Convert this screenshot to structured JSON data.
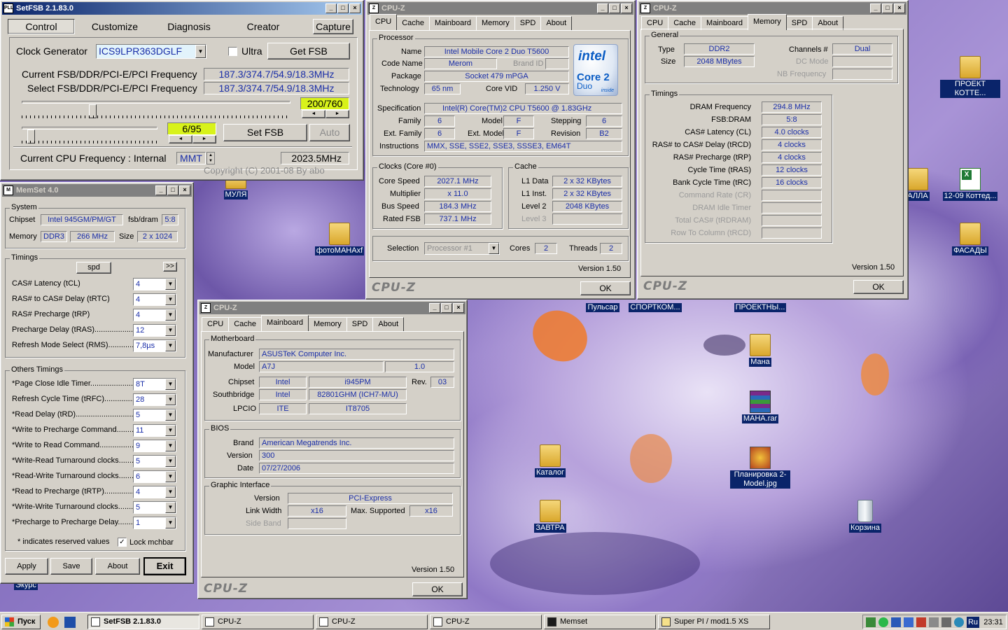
{
  "setfsb": {
    "title": "SetFSB 2.1.83.0",
    "tabs": [
      "Control",
      "Customize",
      "Diagnosis",
      "Creator"
    ],
    "capture": "Capture",
    "clock_label": "Clock Generator",
    "clock_value": "ICS9LPR363DGLF",
    "ultra": "Ultra",
    "get_fsb": "Get FSB",
    "current_label": "Current FSB/DDR/PCI-E/PCI Frequency",
    "current_value": "187.3/374.7/54.9/18.3MHz",
    "select_label": "Select FSB/DDR/PCI-E/PCI Frequency",
    "select_value": "187.3/374.7/54.9/18.3MHz",
    "range1": "200/760",
    "range2": "6/95",
    "set_fsb": "Set FSB",
    "auto": "Auto",
    "cpu_freq_label": "Current CPU Frequency : Internal",
    "mmt": "MMT",
    "cpu_freq_value": "2023.5MHz",
    "copyright": "Copyright (C) 2001-08 By abo"
  },
  "memset": {
    "title": "MemSet 4.0",
    "system": "System",
    "chipset_label": "Chipset",
    "chipset": "Intel 945GM/PM/GT",
    "fsbdram_label": "fsb/dram",
    "fsbdram": "5:8",
    "memory_label": "Memory",
    "mem_type": "DDR3",
    "mem_speed": "266 MHz",
    "size_label": "Size",
    "size": "2 x 1024",
    "timings": "Timings",
    "spd": "spd",
    "more": ">>",
    "timing_rows": [
      {
        "label": "CAS# Latency (tCL)",
        "value": "4"
      },
      {
        "label": "RAS# to CAS# Delay (tRTC)",
        "value": "4"
      },
      {
        "label": "RAS# Precharge (tRP)",
        "value": "4"
      },
      {
        "label": "Precharge Delay  (tRAS).....................",
        "value": "12"
      },
      {
        "label": "Refresh Mode Select (RMS)...............",
        "value": "7,8µs"
      }
    ],
    "others": "Others Timings",
    "other_rows": [
      {
        "label": "*Page Close Idle Timer.......................",
        "value": "8T"
      },
      {
        "label": "Refresh Cycle Time (tRFC)...................",
        "value": "28"
      },
      {
        "label": "*Read Delay (tRD)................................",
        "value": "5"
      },
      {
        "label": "*Write to Precharge Command.............",
        "value": "11"
      },
      {
        "label": "*Write to Read Command......................",
        "value": "9"
      },
      {
        "label": "*Write-Read Turnaround clocks.............",
        "value": "5"
      },
      {
        "label": "*Read-Write Turnaround clocks.............",
        "value": "6"
      },
      {
        "label": "*Read to Precharge (tRTP)....................",
        "value": "4"
      },
      {
        "label": "*Write-Write Turnaround clocks............",
        "value": "5"
      },
      {
        "label": "*Precharge to Precharge Delay.............",
        "value": "1"
      }
    ],
    "note": "* indicates reserved values",
    "lock": "Lock mchbar",
    "apply": "Apply",
    "save": "Save",
    "about": "About",
    "exit": "Exit"
  },
  "cpuz1": {
    "title": "CPU-Z",
    "tabs": [
      "CPU",
      "Cache",
      "Mainboard",
      "Memory",
      "SPD",
      "About"
    ],
    "processor": "Processor",
    "name_l": "Name",
    "name": "Intel Mobile Core 2 Duo T5600",
    "codename_l": "Code Name",
    "codename": "Merom",
    "brandid_l": "Brand ID",
    "package_l": "Package",
    "package": "Socket 479 mPGA",
    "tech_l": "Technology",
    "tech": "65 nm",
    "corevid_l": "Core VID",
    "corevid": "1.250 V",
    "spec_l": "Specification",
    "spec": "Intel(R) Core(TM)2 CPU        T5600  @ 1.83GHz",
    "family_l": "Family",
    "family": "6",
    "model_l": "Model",
    "model": "F",
    "stepping_l": "Stepping",
    "stepping": "6",
    "extfam_l": "Ext. Family",
    "extfam": "6",
    "extmod_l": "Ext. Model",
    "extmod": "F",
    "revision_l": "Revision",
    "revision": "B2",
    "instr_l": "Instructions",
    "instr": "MMX, SSE, SSE2, SSE3, SSSE3, EM64T",
    "clocks": "Clocks (Core #0)",
    "corespeed_l": "Core Speed",
    "corespeed": "2027.1 MHz",
    "mult_l": "Multiplier",
    "mult": "x 11.0",
    "bus_l": "Bus Speed",
    "bus": "184.3 MHz",
    "fsb_l": "Rated FSB",
    "fsb": "737.1 MHz",
    "cache": "Cache",
    "l1d_l": "L1 Data",
    "l1d": "2 x 32 KBytes",
    "l1i_l": "L1 Inst.",
    "l1i": "2 x 32 KBytes",
    "l2_l": "Level 2",
    "l2": "2048 KBytes",
    "l3_l": "Level 3",
    "selection_l": "Selection",
    "selection": "Processor #1",
    "cores_l": "Cores",
    "cores": "2",
    "threads_l": "Threads",
    "threads": "2",
    "version": "Version 1.50",
    "ok": "OK",
    "brand": "CPU-Z",
    "intel_logo": "intel",
    "intel_core": "Core 2",
    "intel_duo": "Duo",
    "intel_inside": "inside"
  },
  "cpuz2": {
    "title": "CPU-Z",
    "tabs": [
      "CPU",
      "Cache",
      "Mainboard",
      "Memory",
      "SPD",
      "About"
    ],
    "general": "General",
    "type_l": "Type",
    "type": "DDR2",
    "size_l": "Size",
    "size": "2048 MBytes",
    "channels_l": "Channels #",
    "channels": "Dual",
    "dcmode_l": "DC Mode",
    "nbfreq_l": "NB Frequency",
    "timings": "Timings",
    "rows": [
      {
        "label": "DRAM Frequency",
        "value": "294.8 MHz"
      },
      {
        "label": "FSB:DRAM",
        "value": "5:8"
      },
      {
        "label": "CAS# Latency (CL)",
        "value": "4.0 clocks"
      },
      {
        "label": "RAS# to CAS# Delay (tRCD)",
        "value": "4 clocks"
      },
      {
        "label": "RAS# Precharge (tRP)",
        "value": "4 clocks"
      },
      {
        "label": "Cycle Time (tRAS)",
        "value": "12 clocks"
      },
      {
        "label": "Bank Cycle Time (tRC)",
        "value": "16 clocks"
      }
    ],
    "dim_rows": [
      "Command Rate (CR)",
      "DRAM Idle Timer",
      "Total CAS# (tRDRAM)",
      "Row To Column (tRCD)"
    ],
    "version": "Version 1.50",
    "ok": "OK",
    "brand": "CPU-Z"
  },
  "cpuz3": {
    "title": "CPU-Z",
    "tabs": [
      "CPU",
      "Cache",
      "Mainboard",
      "Memory",
      "SPD",
      "About"
    ],
    "motherboard": "Motherboard",
    "manuf_l": "Manufacturer",
    "manuf": "ASUSTeK Computer Inc.",
    "model_l": "Model",
    "model": "A7J",
    "model_rev": "1.0",
    "chipset_l": "Chipset",
    "chipset_v": "Intel",
    "chipset_m": "i945PM",
    "rev_l": "Rev.",
    "rev": "03",
    "south_l": "Southbridge",
    "south_v": "Intel",
    "south_m": "82801GHM (ICH7-M/U)",
    "lpcio_l": "LPCIO",
    "lpcio_v": "ITE",
    "lpcio_m": "IT8705",
    "bios": "BIOS",
    "brand_l": "Brand",
    "brand_v": "American Megatrends Inc.",
    "version_l": "Version",
    "version_v": "300",
    "date_l": "Date",
    "date_v": "07/27/2006",
    "graphic": "Graphic Interface",
    "gversion_l": "Version",
    "gversion": "PCI-Express",
    "link_l": "Link Width",
    "link": "x16",
    "max_l": "Max. Supported",
    "max": "x16",
    "side_l": "Side Band",
    "version": "Version 1.50",
    "ok": "OK",
    "brand": "CPU-Z"
  },
  "desktop": {
    "icons": [
      "ПРОЕКТ КОТТЕ...",
      "МУЛЯ",
      "фотоМАНАxf",
      "АЛЛА",
      "12-09 Коттед...",
      "ФАСАДЫ",
      "Пульсар",
      "СПОРТКОМ...",
      "ПРОЕКТНЫ...",
      "Мана",
      "МАНА.rar",
      "Каталог",
      "Планировка 2-Model.jpg",
      "ЗАВТРА",
      "Корзина",
      "Экурс"
    ]
  },
  "taskbar": {
    "start": "Пуск",
    "items": [
      "SetFSB 2.1.83.0",
      "CPU-Z",
      "CPU-Z",
      "CPU-Z",
      "Memset",
      "Super PI / mod1.5 XS"
    ],
    "lang": "Ru",
    "clock": "23:31"
  }
}
